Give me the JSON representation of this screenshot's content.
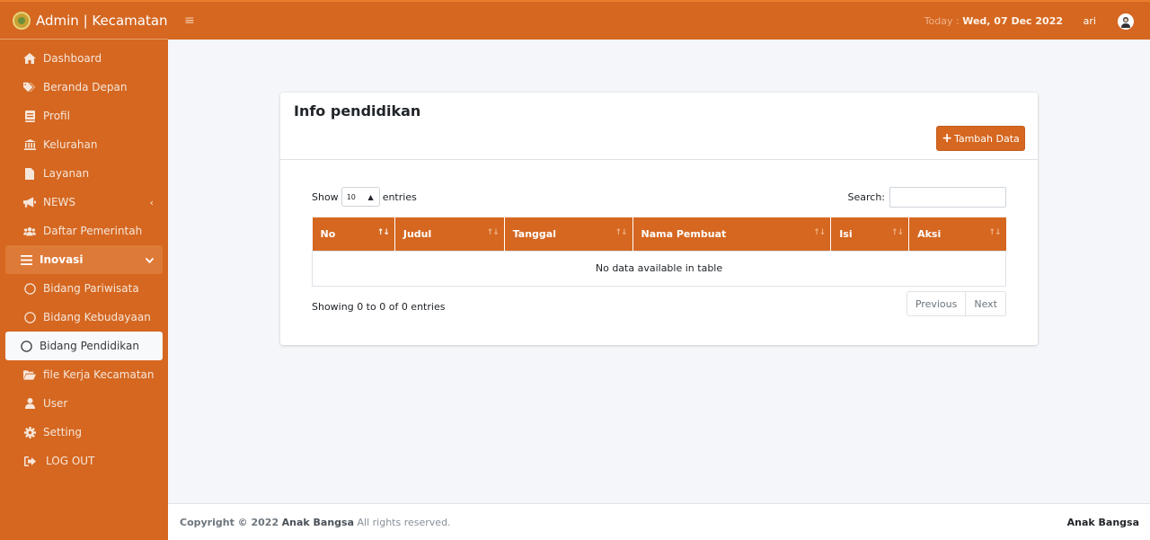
{
  "brand": {
    "title": "Admin | Kecamatan"
  },
  "topbar": {
    "today_label": "Today :",
    "today_value": "Wed, 07 Dec 2022",
    "user": "ari"
  },
  "sidebar": {
    "items": [
      {
        "label": "Dashboard",
        "icon": "home-icon"
      },
      {
        "label": "Beranda Depan",
        "icon": "tags-icon"
      },
      {
        "label": "Profil",
        "icon": "book-icon"
      },
      {
        "label": "Kelurahan",
        "icon": "bank-icon"
      },
      {
        "label": "Layanan",
        "icon": "file-icon"
      },
      {
        "label": "NEWS",
        "icon": "bullhorn-icon"
      },
      {
        "label": "Daftar Pemerintah",
        "icon": "users-icon"
      },
      {
        "label": "Inovasi",
        "icon": "list-icon"
      },
      {
        "label": "Bidang Pariwisata",
        "icon": "circle-icon"
      },
      {
        "label": "Bidang Kebudayaan",
        "icon": "circle-icon"
      },
      {
        "label": "Bidang Pendidikan",
        "icon": "circle-icon"
      },
      {
        "label": "file Kerja Kecamatan",
        "icon": "folder-icon"
      },
      {
        "label": "User",
        "icon": "user-icon"
      },
      {
        "label": "Setting",
        "icon": "cog-icon"
      },
      {
        "label": "LOG OUT",
        "icon": "sign-out-icon"
      }
    ]
  },
  "card": {
    "title": "Info pendidikan",
    "add_button": "Tambah Data",
    "show_label": "Show",
    "entries_value": "10",
    "entries_label": "entries",
    "search_label": "Search:",
    "columns": [
      "No",
      "Judul",
      "Tanggal",
      "Nama Pembuat",
      "Isi",
      "Aksi"
    ],
    "empty_message": "No data available in table",
    "info": "Showing 0 to 0 of 0 entries",
    "prev": "Previous",
    "next": "Next"
  },
  "footer": {
    "copyright": "Copyright © 2022",
    "company": "Anak Bangsa",
    "rights": "All rights reserved.",
    "right_text": "Anak Bangsa"
  },
  "colors": {
    "primary": "#d56720",
    "sidebar_active_parent": "#de7a38",
    "background": "#f4f6f9"
  }
}
